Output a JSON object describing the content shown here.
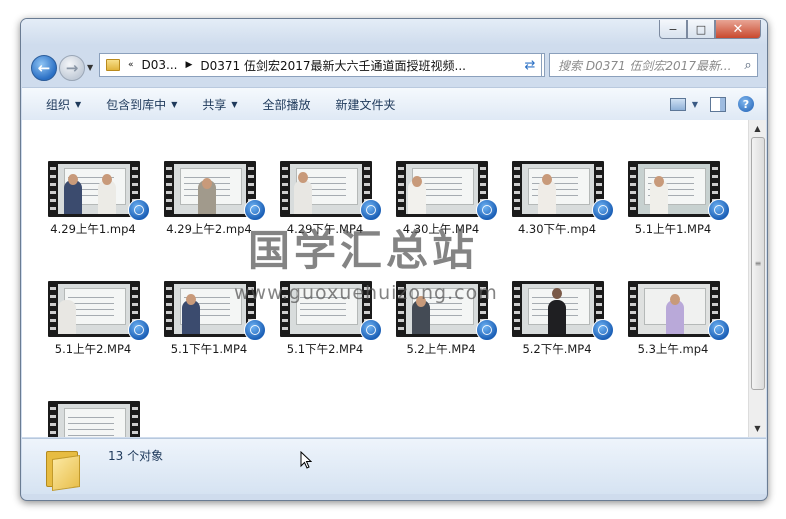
{
  "window": {
    "title": ""
  },
  "titlebar": {
    "min": "−",
    "max": "□",
    "close": "✕"
  },
  "nav": {
    "back_icon": "back-arrow-icon",
    "forward_icon": "forward-arrow-icon",
    "breadcrumb_root": "D03...",
    "breadcrumb_prefix": "«",
    "path": "D0371 伍剑宏2017最新大六壬通道面授班视频...",
    "search_placeholder": "搜索 D0371 伍剑宏2017最新..."
  },
  "toolbar": {
    "organize": "组织",
    "include_library": "包含到库中",
    "share": "共享",
    "play_all": "全部播放",
    "new_folder": "新建文件夹",
    "help": "?"
  },
  "files": [
    {
      "name": "4.29上午1.mp4"
    },
    {
      "name": "4.29上午2.mp4"
    },
    {
      "name": "4.29下午.MP4"
    },
    {
      "name": "4.30上午.MP4"
    },
    {
      "name": "4.30下午.mp4"
    },
    {
      "name": "5.1上午1.MP4"
    },
    {
      "name": "5.1上午2.MP4"
    },
    {
      "name": "5.1下午1.MP4"
    },
    {
      "name": "5.1下午2.MP4"
    },
    {
      "name": "5.2上午.MP4"
    },
    {
      "name": "5.2下午.MP4"
    },
    {
      "name": "5.3上午.mp4"
    },
    {
      "name": ""
    }
  ],
  "watermark": {
    "line1": "国学汇总站",
    "line2": "www.guoxuehuizong.com"
  },
  "details": {
    "count": "13 个对象"
  },
  "colors": {
    "accent": "#2a6fc4",
    "badge": "#1b5fb6"
  }
}
